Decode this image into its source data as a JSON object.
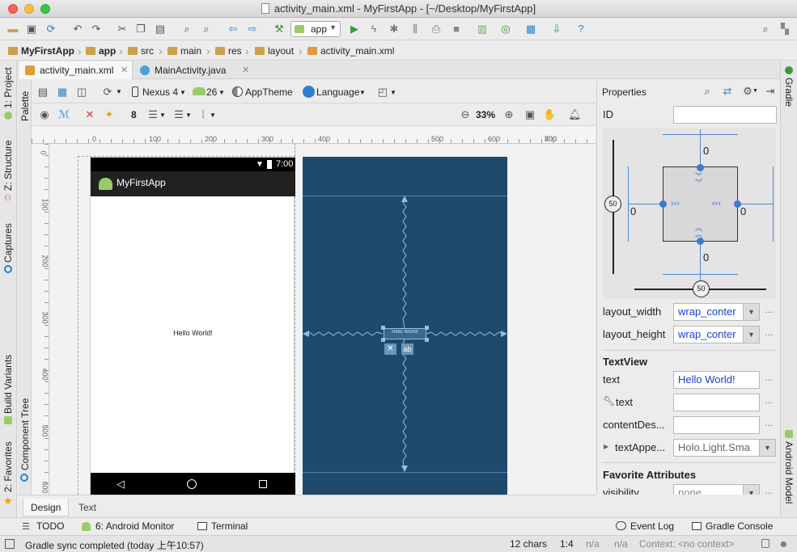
{
  "window": {
    "title": "activity_main.xml - MyFirstApp - [~/Desktop/MyFirstApp]"
  },
  "toolbar": {
    "run_config": "app"
  },
  "breadcrumbs": [
    "MyFirstApp",
    "app",
    "src",
    "main",
    "res",
    "layout",
    "activity_main.xml"
  ],
  "tabs": [
    {
      "label": "activity_main.xml",
      "active": true
    },
    {
      "label": "MainActivity.java",
      "active": false
    }
  ],
  "left_strip": {
    "project": "1: Project",
    "structure": "Z: Structure",
    "captures": "Captures",
    "build_variants": "Build Variants",
    "favorites": "2: Favorites"
  },
  "right_strip": {
    "gradle": "Gradle",
    "android_model": "Android Model"
  },
  "palette_strip": {
    "palette": "Palette",
    "component_tree": "Component Tree"
  },
  "editor_toolbar": {
    "device": "Nexus 4",
    "api": "26",
    "theme": "AppTheme",
    "language": "Language",
    "margin": "8",
    "zoom": "33%"
  },
  "ruler": {
    "top": [
      "0",
      "100",
      "200",
      "300",
      "400",
      "500",
      "600",
      "700",
      "800"
    ],
    "left": [
      "0",
      "100",
      "200",
      "300",
      "400",
      "500",
      "600"
    ]
  },
  "phone": {
    "status_time": "7:00",
    "app_title": "MyFirstApp",
    "content_text": "Hello World!"
  },
  "blueprint": {
    "widget_label": "Hello World!"
  },
  "design_tabs": [
    "Design",
    "Text"
  ],
  "properties": {
    "title": "Properties",
    "id_label": "ID",
    "id_value": "",
    "constraints": {
      "top": "0",
      "left": "0",
      "right": "0",
      "bottom": "0",
      "vbias": "50",
      "hbias": "50"
    },
    "layout_width_label": "layout_width",
    "layout_width_value": "wrap_conter",
    "layout_height_label": "layout_height",
    "layout_height_value": "wrap_conter",
    "textview_header": "TextView",
    "text_label": "text",
    "text_value": "Hello World!",
    "tools_text_label": "text",
    "tools_text_value": "",
    "content_desc_label": "contentDes...",
    "content_desc_value": "",
    "text_appearance_label": "textAppe...",
    "text_appearance_value": "Holo.Light.Sma",
    "favorite_header": "Favorite Attributes",
    "visibility_label": "visibility",
    "visibility_value": "none"
  },
  "bottom_bar": {
    "todo": "TODO",
    "android_monitor": "6: Android Monitor",
    "terminal": "Terminal",
    "event_log": "Event Log",
    "gradle_console": "Gradle Console"
  },
  "status_bar": {
    "message": "Gradle sync completed (today 上午10:57)",
    "chars": "12 chars",
    "position": "1:4",
    "na1": "n/a",
    "na2": "n/a",
    "context": "Context: <no context>"
  }
}
